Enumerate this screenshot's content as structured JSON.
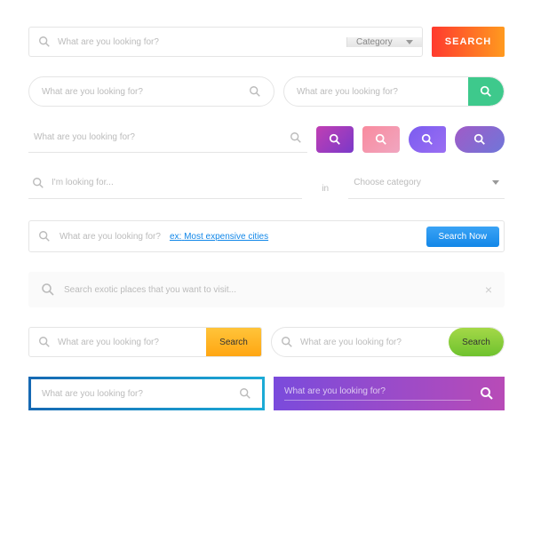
{
  "placeholders": {
    "looking": "What are you looking for?",
    "im_looking": "I'm looking for...",
    "exotic": "Search exotic places that you want to visit..."
  },
  "labels": {
    "category": "Category",
    "choose_category": "Choose category",
    "in": "in"
  },
  "buttons": {
    "search_caps": "SEARCH",
    "search": "Search",
    "search_now": "Search Now"
  },
  "example": {
    "prefix": "ex:",
    "text": "Most expensive cities"
  }
}
